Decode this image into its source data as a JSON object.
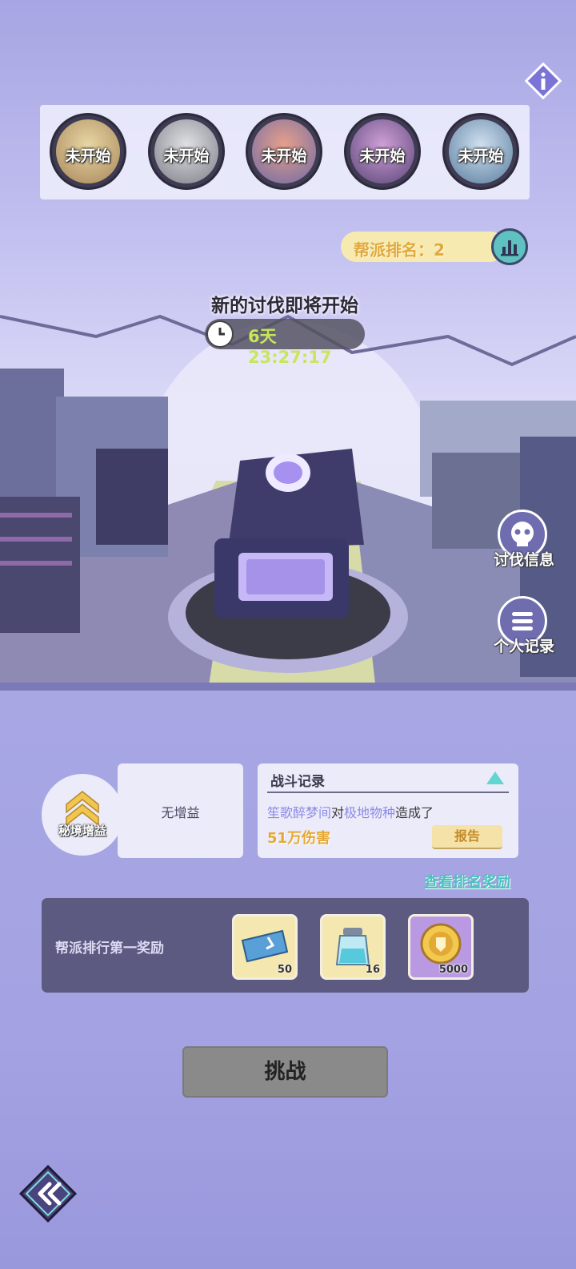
{
  "bosses": [
    {
      "status": "未开始",
      "tint": "#b89a64"
    },
    {
      "status": "未开始",
      "tint": "#8b8f98"
    },
    {
      "status": "未开始",
      "tint": "#a47fa8"
    },
    {
      "status": "未开始",
      "tint": "#8b6aa4"
    },
    {
      "status": "未开始",
      "tint": "#6f8fb0"
    }
  ],
  "rank": {
    "label": "帮派排名：2"
  },
  "hunt": {
    "headline": "新的讨伐即将开始",
    "countdown": "6天 23:27:17"
  },
  "side_buttons": {
    "hunt_info": "讨伐信息",
    "personal_record": "个人记录"
  },
  "buff": {
    "label": "秘境增益",
    "value": "无增益"
  },
  "battle_record": {
    "title": "战斗记录",
    "player": "笙歌醉梦间",
    "verb": "对",
    "monster": "极地物种",
    "suffix": "造成了",
    "damage": "51万伤害",
    "report_button": "报告"
  },
  "rank_reward_link": "查看排名奖励",
  "rewards": {
    "title": "帮派排行第一奖励",
    "items": [
      {
        "icon": "ticket-icon",
        "qty": "50"
      },
      {
        "icon": "potion-bottle-icon",
        "qty": "16"
      },
      {
        "icon": "gold-coin-icon",
        "qty": "5000"
      }
    ]
  },
  "challenge_button": "挑战",
  "colors": {
    "accent_teal": "#4ac1bf",
    "gold": "#e5a833",
    "panel_dark": "#5d5a82"
  }
}
